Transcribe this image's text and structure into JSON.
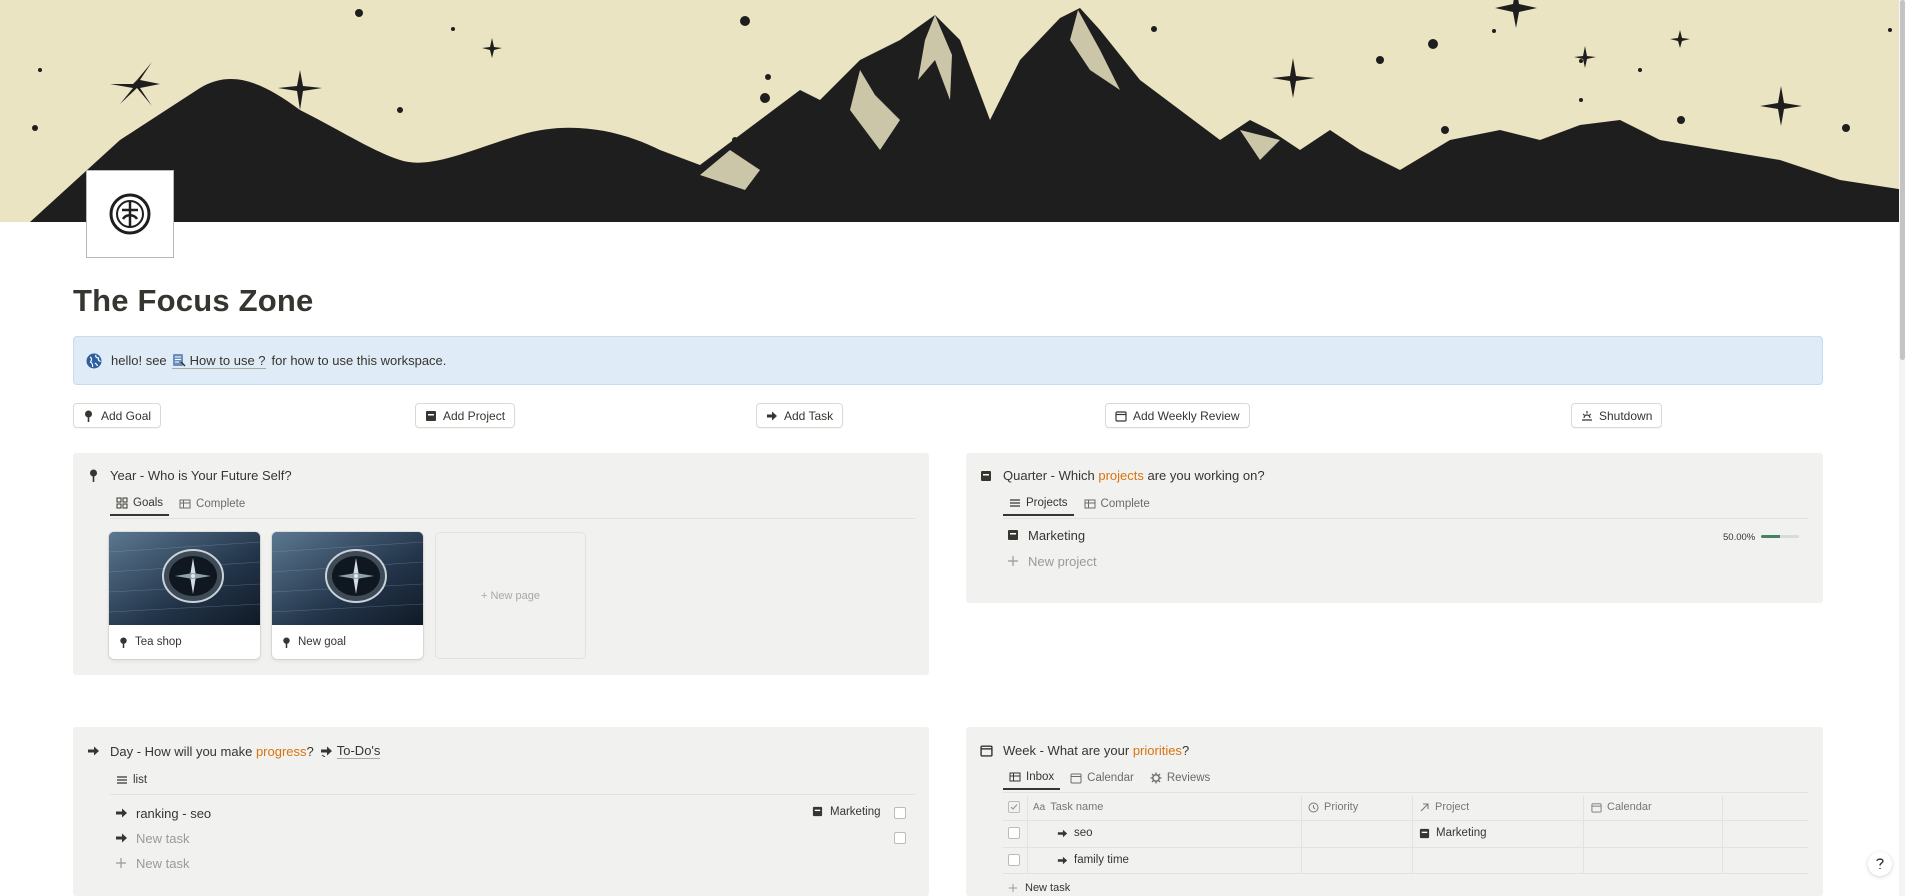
{
  "page": {
    "title": "The Focus Zone"
  },
  "callout": {
    "prefix": "hello! see",
    "link_label": "How to use ?",
    "suffix": "for how to use this workspace."
  },
  "buttons": {
    "add_goal": "Add Goal",
    "add_project": "Add Project",
    "add_task": "Add Task",
    "add_weekly_review": "Add Weekly Review",
    "shutdown": "Shutdown"
  },
  "year": {
    "heading_text": "Year - Who is Your Future Self?",
    "tabs": [
      "Goals",
      "Complete"
    ],
    "cards": [
      {
        "title": "Tea shop"
      },
      {
        "title": "New goal"
      }
    ],
    "new_page_label": "+ New page"
  },
  "quarter": {
    "heading_before": "Quarter - Which ",
    "heading_highlight": "projects",
    "heading_after": " are you working on?",
    "tabs": [
      "Projects",
      "Complete"
    ],
    "project": {
      "name": "Marketing",
      "progress_label": "50.00%",
      "progress": 0.5
    },
    "new_project_label": "New project"
  },
  "day": {
    "heading_before": "Day - How will you make ",
    "heading_highlight": "progress",
    "heading_after": "?",
    "heading_link": "To-Do's",
    "tabs": [
      "list"
    ],
    "rows": [
      {
        "title": "ranking - seo",
        "project": "Marketing"
      },
      {
        "title": "New task"
      }
    ],
    "new_task_label": "New task"
  },
  "week": {
    "heading_before": "Week - What are your ",
    "heading_highlight": "priorities",
    "heading_after": "?",
    "tabs": [
      "Inbox",
      "Calendar",
      "Reviews"
    ],
    "columns": [
      "Task name",
      "Priority",
      "Project",
      "Calendar"
    ],
    "rows": [
      {
        "task": "seo",
        "project": "Marketing"
      },
      {
        "task": "family time",
        "project": ""
      }
    ],
    "new_task_label": "New task"
  },
  "colors": {
    "cover_bg": "#ebe4c2",
    "callout_bg": "#dfebf6",
    "panel_bg": "#f1f1ef",
    "accent_orange": "#d9730d",
    "progress_green": "#448361"
  },
  "icons": {
    "callout": "globe-icon",
    "help": "help-icon"
  }
}
